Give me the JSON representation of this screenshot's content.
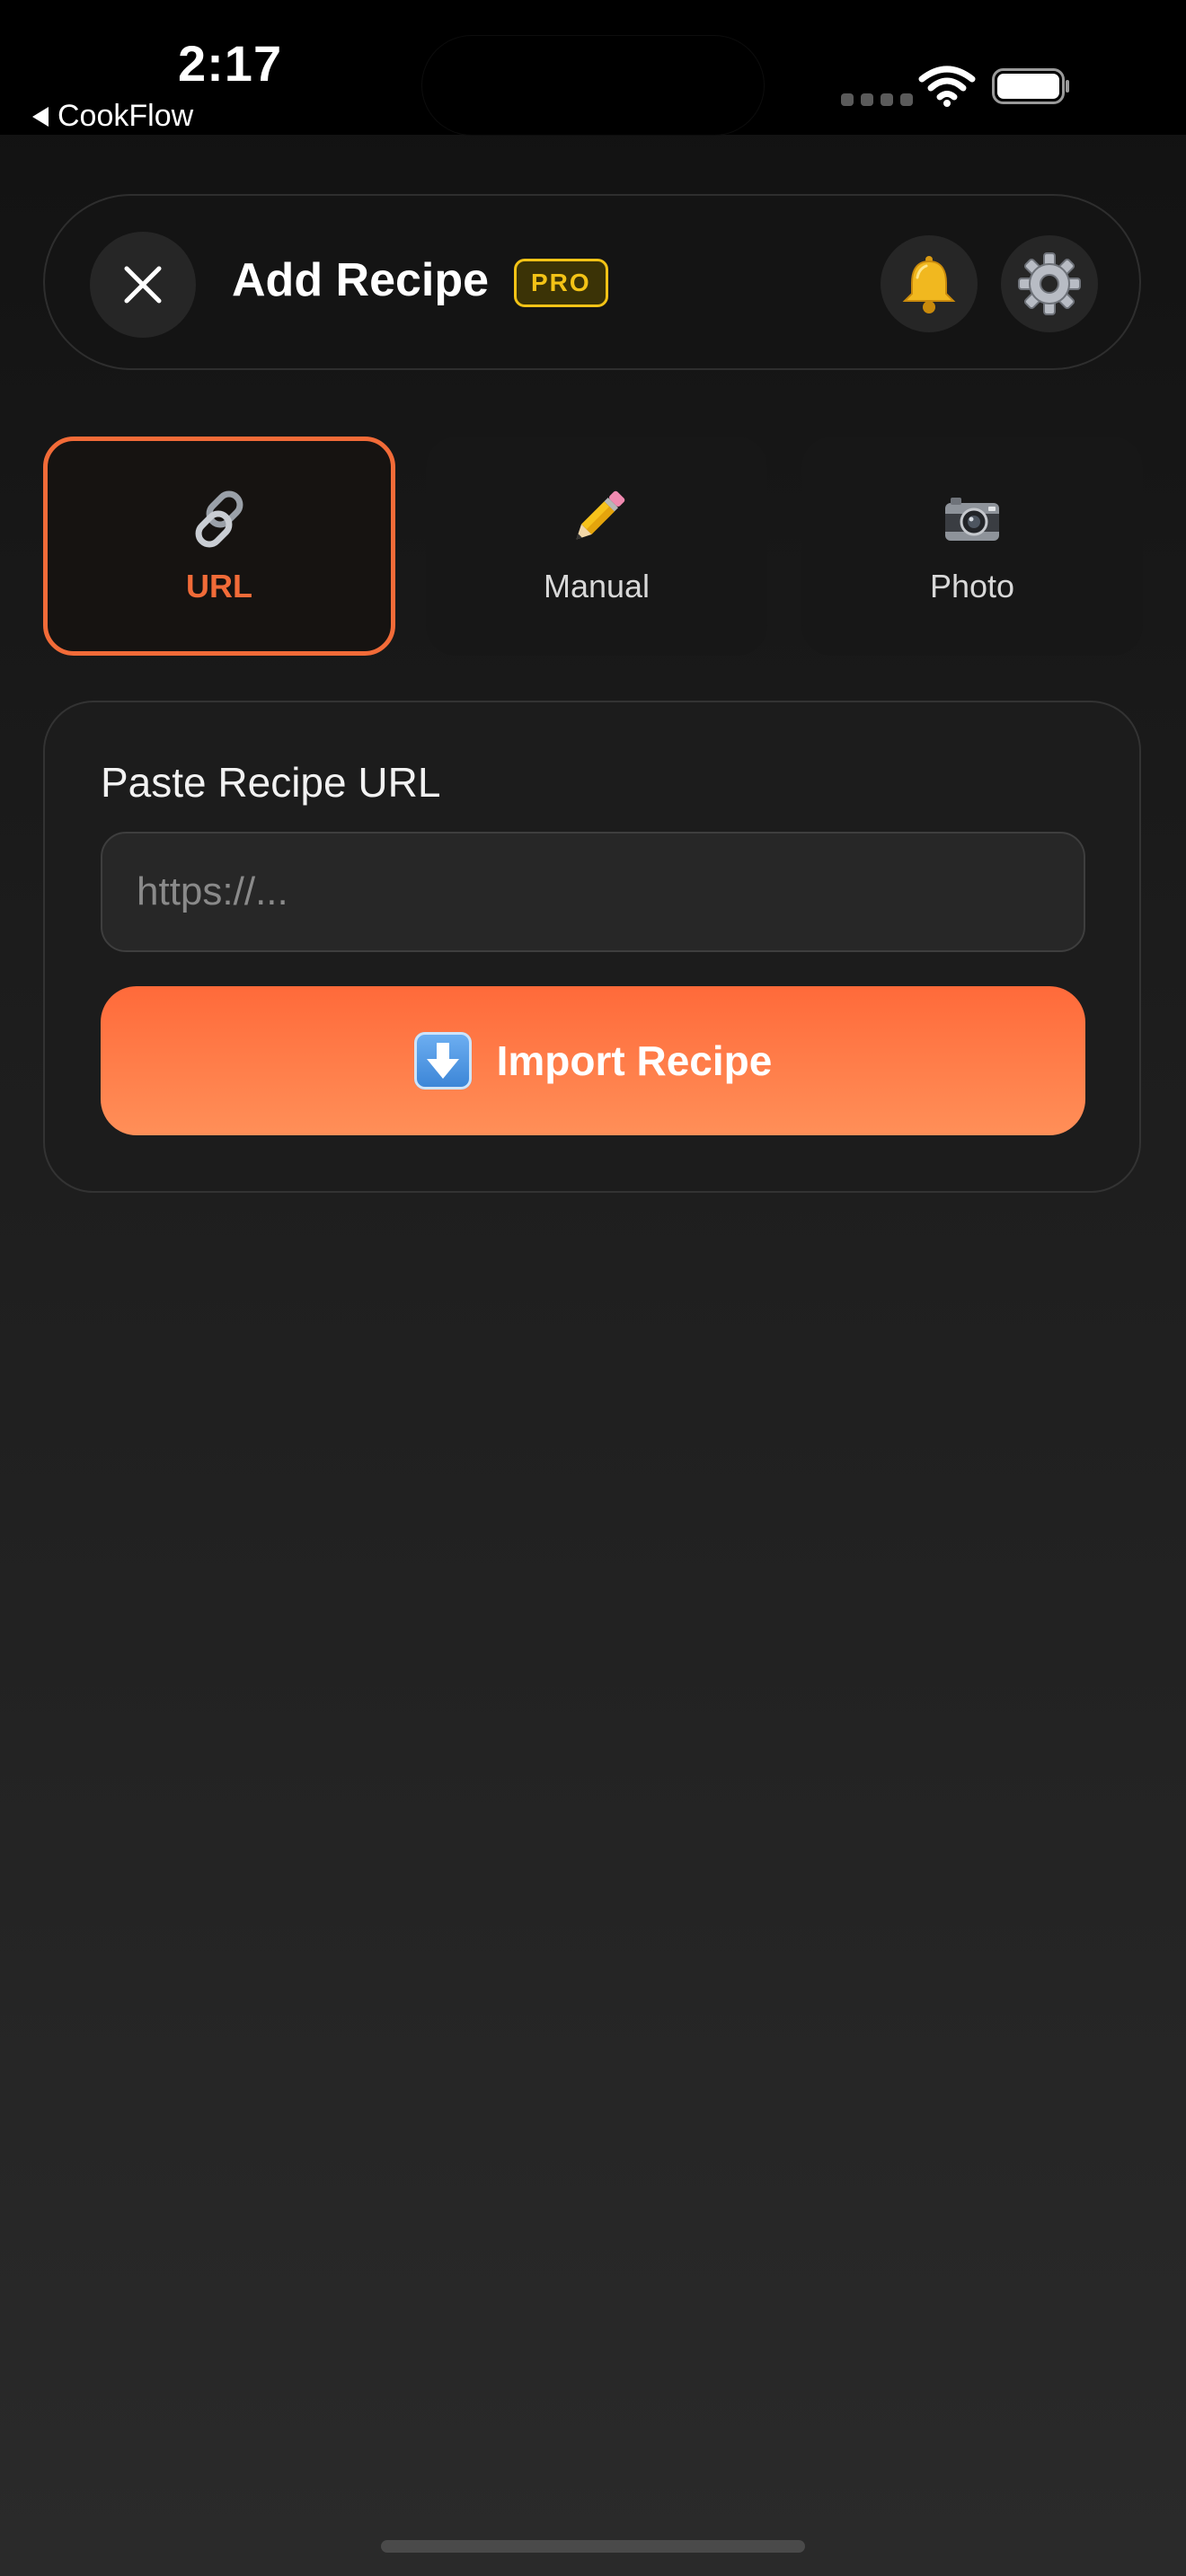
{
  "status_bar": {
    "time": "2:17",
    "back_app_label": "CookFlow"
  },
  "header": {
    "title": "Add Recipe",
    "badge": "PRO",
    "icons": {
      "close": "close-icon",
      "notifications": "bell-icon",
      "settings": "gear-icon"
    }
  },
  "tabs": [
    {
      "label": "URL",
      "icon": "link-icon",
      "selected": true
    },
    {
      "label": "Manual",
      "icon": "pencil-icon",
      "selected": false
    },
    {
      "label": "Photo",
      "icon": "camera-icon",
      "selected": false
    }
  ],
  "url_import": {
    "label": "Paste Recipe URL",
    "input_value": "",
    "placeholder": "https://...",
    "button_label": "Import Recipe",
    "button_icon": "download-icon"
  },
  "colors": {
    "accent": "#f26b38",
    "badge": "#f3c316",
    "background": "#1d1d1d"
  }
}
